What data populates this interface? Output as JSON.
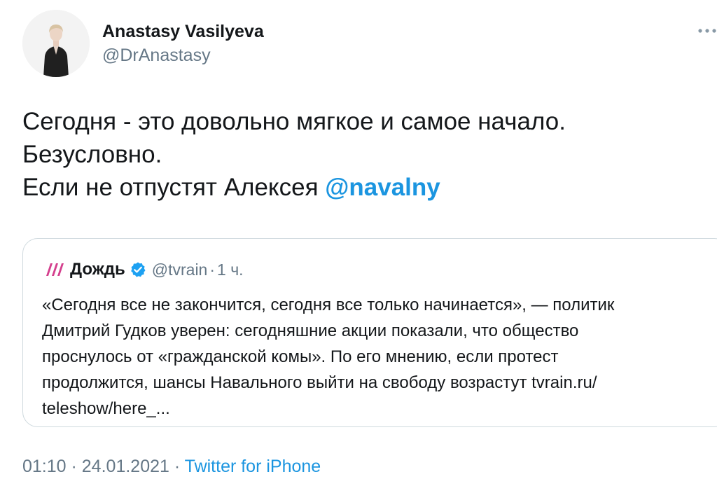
{
  "author": {
    "name": "Anastasy Vasilyeva",
    "handle": "@DrAnastasy",
    "avatar_icon": "profile-photo-icon"
  },
  "tweet": {
    "line1": "Сегодня - это довольно мягкое и самое начало.",
    "line2": "Безусловно.",
    "line3_prefix": "Если не отпустят Алексея ",
    "mention": "@navalny"
  },
  "quote": {
    "logo_icon": "tvrain-logo-icon",
    "name": "Дождь",
    "verified_icon": "verified-badge-icon",
    "handle": "@tvrain",
    "separator": "·",
    "time": "1 ч.",
    "lines": [
      "«Сегодня все не закончится, сегодня все только начинается», — политик",
      "Дмитрий Гудков уверен: сегодняшние акции показали, что общество",
      "проснулось от «гражданской комы». По его мнению, если протест",
      "продолжится, шансы Навального выйти на свободу возрастут tvrain.ru/",
      "teleshow/here_..."
    ]
  },
  "meta": {
    "time": "01:10",
    "separator1": " · ",
    "date": "24.01.2021",
    "separator2": " · ",
    "source": "Twitter for iPhone"
  },
  "menu": {
    "more_icon": "more-options-icon"
  },
  "colors": {
    "link": "#1b95e0",
    "secondary_text": "#657786",
    "border": "#cfd9de",
    "verified": "#1da1f2",
    "tvrain_logo": "#d43f8d"
  }
}
